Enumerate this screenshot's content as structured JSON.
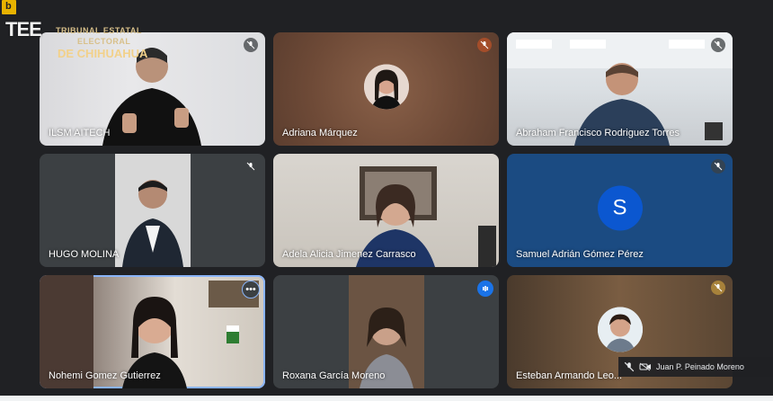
{
  "logo": {
    "mark": "TEE",
    "line1": "TRIBUNAL ESTATAL",
    "line2": "ELECTORAL",
    "line3": "DE CHIHUAHUA"
  },
  "tiles": [
    {
      "name": "ILSM AITECH",
      "muted": true
    },
    {
      "name": "Adriana Márquez",
      "muted": true
    },
    {
      "name": "Abraham Francisco Rodriguez Torres",
      "muted": true
    },
    {
      "name": "HUGO MOLINA",
      "muted": true
    },
    {
      "name": "Adela Alicia Jimenez Carrasco",
      "muted": false
    },
    {
      "name": "Samuel Adrián Gómez Pérez",
      "muted": true,
      "initial": "S"
    },
    {
      "name": "Nohemi Gomez Gutierrez",
      "muted": false
    },
    {
      "name": "Roxana García Moreno",
      "muted": false
    },
    {
      "name": "Esteban Armando Leo...",
      "muted": true
    }
  ],
  "self_view": {
    "name": "Juan P. Peinado Moreno"
  },
  "colors": {
    "background": "#202124",
    "accent": "#8ab4f8",
    "avatar_blue": "#0b57d0"
  }
}
